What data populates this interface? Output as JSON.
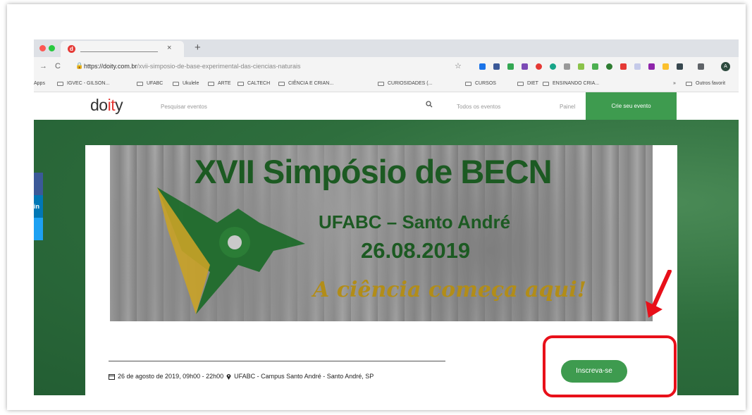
{
  "tab": {
    "close_glyph": "×",
    "new_tab_glyph": "+",
    "favicon_letter": "d"
  },
  "address": {
    "back_glyph": "→",
    "reload_glyph": "C",
    "url_host": "https://doity.com.br",
    "url_path": "/xvii-simposio-de-base-experimental-das-ciencias-naturais",
    "star_glyph": "☆",
    "profile_initial": "A"
  },
  "bookmarks": {
    "items": [
      "Apps",
      "IGVEC - GILSON...",
      "UFABC",
      "Ukulele",
      "ARTE",
      "CALTECH",
      "CIÊNCIA E CRIAN...",
      "CURIOSIDADES (...",
      "CURSOS",
      "DIET",
      "ENSINANDO CRIA...",
      "»",
      "Outros favorit"
    ]
  },
  "site": {
    "logo_prefix": "do",
    "logo_accent": "it",
    "logo_suffix": "y",
    "search_placeholder": "Pesquisar eventos",
    "nav_all_events": "Todos os eventos",
    "nav_panel": "Painel",
    "create_event": "Crie seu evento"
  },
  "banner": {
    "title": "XVII Simpósio de BECN",
    "location": "UFABC – Santo André",
    "date": "26.08.2019",
    "tagline": "A ciência começa aqui!"
  },
  "event": {
    "date_time": "26 de agosto de 2019, 09h00 - 22h00",
    "venue": "UFABC - Campus Santo André - Santo André, SP",
    "register_label": "Inscreva-se"
  },
  "side_buttons": [
    "f",
    "in",
    "t"
  ],
  "colors": {
    "brand_green": "#3e9b4f",
    "banner_text_green": "#1c5a22",
    "tagline_gold": "#b28d18",
    "annotation_red": "#e8101a",
    "logo_red": "#e53935"
  },
  "icons": {
    "calendar": "calendar-icon",
    "pin": "map-pin-icon",
    "search": "search-icon",
    "lock": "lock-icon"
  }
}
